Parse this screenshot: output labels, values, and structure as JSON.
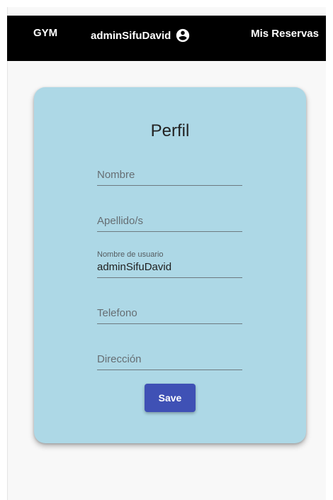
{
  "navbar": {
    "brand": "GYM",
    "username": "adminSifuDavid",
    "account_icon": "account-circle-icon",
    "reservations_link": "Mis Reservas"
  },
  "form": {
    "title": "Perfil",
    "fields": {
      "nombre": {
        "placeholder": "Nombre",
        "value": ""
      },
      "apellidos": {
        "placeholder": "Apellido/s",
        "value": ""
      },
      "usuario": {
        "label": "Nombre de usuario",
        "value": "adminSifuDavid"
      },
      "telefono": {
        "placeholder": "Telefono",
        "value": ""
      },
      "direccion": {
        "placeholder": "Dirección",
        "value": ""
      }
    },
    "save_label": "Save"
  },
  "colors": {
    "navbar": "#000000",
    "card": "#add8e6",
    "primary_button": "#3f51b5",
    "page_background": "#f8f8f8"
  }
}
